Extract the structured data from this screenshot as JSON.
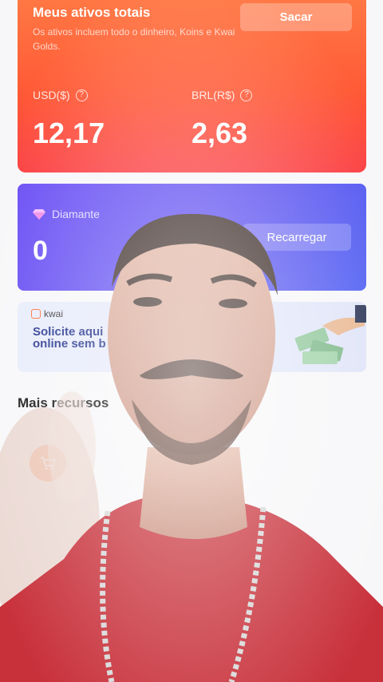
{
  "assets": {
    "title": "Meus ativos totais",
    "description": "Os ativos incluem todo o dinheiro, Koins e Kwai Golds.",
    "withdraw_label": "Sacar",
    "currencies": [
      {
        "label": "USD($)",
        "value": "12,17"
      },
      {
        "label": "BRL(R$)",
        "value": "2,63"
      }
    ]
  },
  "diamond": {
    "label": "Diamante",
    "value": "0",
    "recharge_label": "Recarregar"
  },
  "banner": {
    "brand": "kwai",
    "text": "Solicite aqui\nonline sem b"
  },
  "more_features": {
    "title": "Mais recursos"
  },
  "icons": {
    "help": "help-circle-icon",
    "diamond": "diamond-icon",
    "shop": "shop-cart-icon"
  },
  "colors": {
    "assets_card": "#ff5a36",
    "diamond_card": "#5b4ef0",
    "banner_text": "#1e2f8a"
  }
}
